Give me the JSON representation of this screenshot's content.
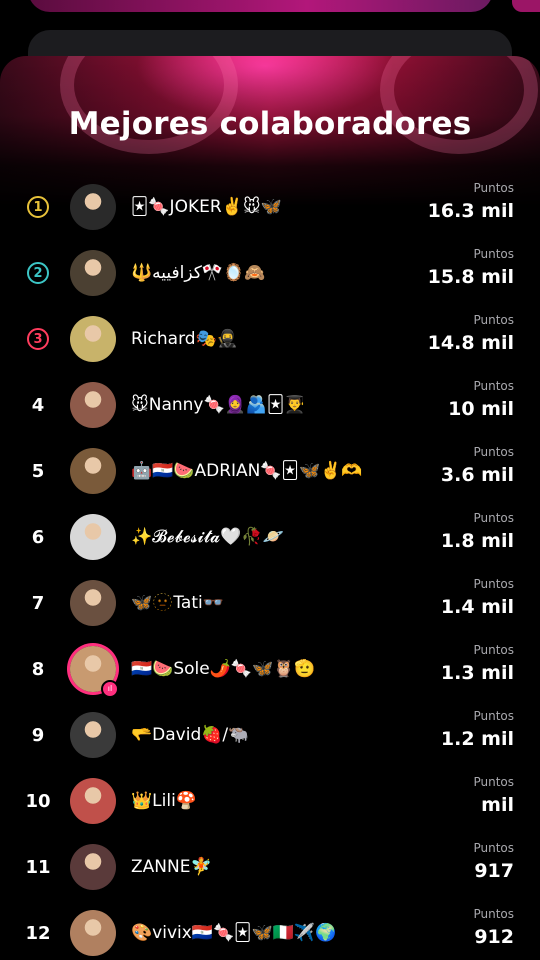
{
  "title": "Mejores colaboradores",
  "points_label": "Puntos",
  "colors": {
    "gold": "#e8c23a",
    "silver": "#3cc6c6",
    "bronze": "#ff3d5e",
    "live": "#ff2f7e"
  },
  "rows": [
    {
      "rank": "1",
      "name": "🃏🍬JOKER✌️🐭🦋",
      "points": "16.3 mil",
      "avatar": "#2a2a2a"
    },
    {
      "rank": "2",
      "name": "🔱كزافييه🎌🪞🙈",
      "points": "15.8 mil",
      "avatar": "#4b4032"
    },
    {
      "rank": "3",
      "name": "Richard🎭🥷",
      "points": "14.8 mil",
      "avatar": "#c8b36a"
    },
    {
      "rank": "4",
      "name": "🐭Nanny🍬🧕🫂🃏👨‍🎓",
      "points": "10 mil",
      "avatar": "#8e5a4a"
    },
    {
      "rank": "5",
      "name": "🤖🇵🇾🍉ADRIAN🍬🃏🦋✌️🫶",
      "points": "3.6 mil",
      "avatar": "#7a5a3a"
    },
    {
      "rank": "6",
      "name": "✨𝓑𝓮𝓫𝓮𝓼𝓲𝓽𝓪🤍🥀🪐",
      "points": "1.8 mil",
      "avatar": "#d8d8d8"
    },
    {
      "rank": "7",
      "name": "🦋🫥Tati👓",
      "points": "1.4 mil",
      "avatar": "#6a5040"
    },
    {
      "rank": "8",
      "name": "🇵🇾🍉Sole🌶️🍬🦋🦉🫡",
      "points": "1.3 mil",
      "avatar": "#c89a70",
      "live": true
    },
    {
      "rank": "9",
      "name": "🫳David🍓/🐃",
      "points": "1.2 mil",
      "avatar": "#3a3a3a"
    },
    {
      "rank": "10",
      "name": "👑Lili🍄",
      "points": "mil",
      "avatar": "#c0504a"
    },
    {
      "rank": "11",
      "name": "ZANNE🧚",
      "points": "917",
      "avatar": "#5a3a3a"
    },
    {
      "rank": "12",
      "name": "🎨vivix🇵🇾🍬🃏🦋🇮🇹✈️🌍",
      "points": "912",
      "avatar": "#b08060"
    }
  ]
}
